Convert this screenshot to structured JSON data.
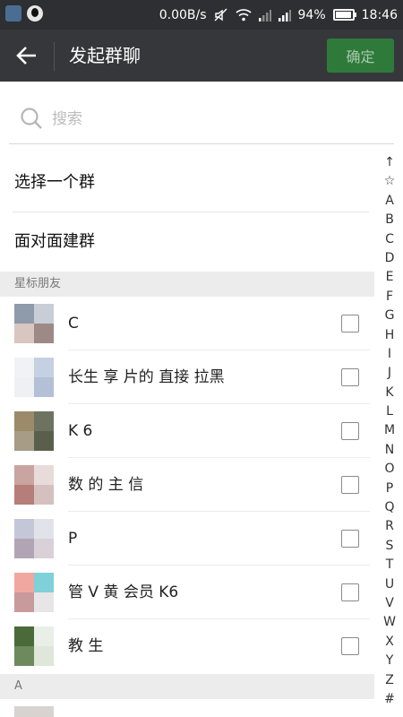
{
  "status_bar": {
    "speed": "0.00B/s",
    "battery_percent": "94%",
    "battery_level": 0.94,
    "time": "18:46"
  },
  "title_bar": {
    "title": "发起群聊",
    "confirm_label": "确定"
  },
  "search": {
    "placeholder": "搜索"
  },
  "options": [
    {
      "label": "选择一个群"
    },
    {
      "label": "面对面建群"
    }
  ],
  "sections": [
    {
      "label": "星标朋友"
    },
    {
      "label": "A"
    }
  ],
  "contacts": [
    {
      "name": "C",
      "avatar_colors": [
        "#8f9aab",
        "#c9cdd6",
        "#d9c6c1",
        "#9d8a86"
      ]
    },
    {
      "name": "长生 享 片的 直接 拉黑",
      "avatar_colors": [
        "#f0f2f5",
        "#c6d0e3",
        "#eef0f3",
        "#b4c0d6"
      ]
    },
    {
      "name": "K 6",
      "avatar_colors": [
        "#9c8a6a",
        "#6d7360",
        "#a79c84",
        "#5a5f4c"
      ]
    },
    {
      "name": "数 的 主 信",
      "avatar_colors": [
        "#c9a4a1",
        "#e8dcda",
        "#b57e7a",
        "#d4c1bf"
      ]
    },
    {
      "name": "P",
      "avatar_colors": [
        "#c4c7d8",
        "#e2e3ea",
        "#b1a5b5",
        "#d9d0d8"
      ]
    },
    {
      "name": "管 V 黄 会员 K6",
      "avatar_colors": [
        "#f0a7a0",
        "#7fd0d8",
        "#c99a9c",
        "#e8e5e6"
      ]
    },
    {
      "name": "教 生",
      "avatar_colors": [
        "#4a6a3a",
        "#e9eee6",
        "#6c8a5b",
        "#dfe6da"
      ]
    }
  ],
  "index_letters": [
    "↑",
    "☆",
    "A",
    "B",
    "C",
    "D",
    "E",
    "F",
    "G",
    "H",
    "I",
    "J",
    "K",
    "L",
    "M",
    "N",
    "O",
    "P",
    "Q",
    "R",
    "S",
    "T",
    "U",
    "V",
    "W",
    "X",
    "Y",
    "Z",
    "#"
  ]
}
